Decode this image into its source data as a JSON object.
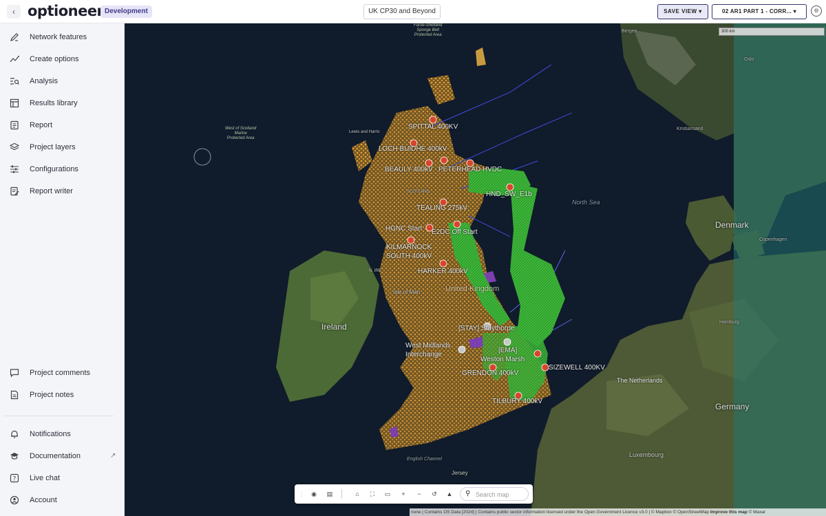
{
  "app": {
    "logo": "optioneer",
    "environment": "Development",
    "project": "UK CP30 and Beyond",
    "save_view": "SAVE VIEW ▾",
    "scenario": "02 AR1 PART 1 - CORR... ▾"
  },
  "sidebar": {
    "items": [
      {
        "label": "Network features",
        "icon": "pen-icon"
      },
      {
        "label": "Create options",
        "icon": "route-icon"
      },
      {
        "label": "Analysis",
        "icon": "analysis-icon"
      },
      {
        "label": "Results library",
        "icon": "table-icon"
      },
      {
        "label": "Report",
        "icon": "report-icon"
      },
      {
        "label": "Project layers",
        "icon": "layers-icon"
      },
      {
        "label": "Configurations",
        "icon": "sliders-icon"
      },
      {
        "label": "Report writer",
        "icon": "report-writer-icon"
      }
    ],
    "bottom_items": [
      {
        "label": "Project comments",
        "icon": "comment-icon"
      },
      {
        "label": "Project notes",
        "icon": "notes-icon"
      },
      {
        "label": "Notifications",
        "icon": "bell-icon"
      },
      {
        "label": "Documentation",
        "icon": "graduation-cap-icon"
      },
      {
        "label": "Live chat",
        "icon": "help-icon"
      },
      {
        "label": "Account",
        "icon": "user-icon"
      }
    ]
  },
  "map": {
    "scale": "300 km",
    "countries": {
      "ireland": "Ireland",
      "denmark": "Denmark",
      "germany": "Germany",
      "netherlands": "The Netherlands",
      "uk": "United Kingdom"
    },
    "places": {
      "bergen": "Bergen",
      "oslo": "Oslo",
      "kristiansand": "Kristiansand",
      "hamburg": "Hamburg",
      "luxembourg": "Luxembourg",
      "jersey": "Jersey",
      "isle_of_man": "Isle of Man",
      "n_ireland": "N. IRE",
      "scotland": "SCOTLAND",
      "english_channel": "English Channel",
      "north_sea": "North Sea",
      "copenhagen": "Copenhagen",
      "lewis": "Lewis and Harris"
    },
    "marine_areas": {
      "west_scotland": "West of Scotland\nMarine\nProtected Area",
      "sponge_belt": "Faroe-Shetland\nSponge Belt\nProtected Area"
    },
    "substations": [
      {
        "label": "SPITTAL 400KV"
      },
      {
        "label": "LOCH BUIDHE 400kV"
      },
      {
        "label": "BEAULY 400kV"
      },
      {
        "label": "PETERHEAD HVDC"
      },
      {
        "label": "HND_SW_E1b"
      },
      {
        "label": "TEALING 275kV"
      },
      {
        "label": "HGNC Start"
      },
      {
        "label": "E2DC Off Start"
      },
      {
        "label": "KILMARNOCK SOUTH 400kV"
      },
      {
        "label": "HARKER 400kV"
      },
      {
        "label": "[STAY] Staythorpe"
      },
      {
        "label": "West Midlands Interchange"
      },
      {
        "label": "[EMA]"
      },
      {
        "label": "Weston Marsh"
      },
      {
        "label": "SIZEWELL 400KV"
      },
      {
        "label": "GRENDON 400kV"
      },
      {
        "label": "TILBURY 400kV"
      }
    ],
    "search_placeholder": "Search map",
    "attribution": "none | Contains OS Data [2024] | Contains public sector information licensed under the Open Government Licence v3.0 | © Mapbox © OpenStreetMap ",
    "attribution_bold": "Improve this map",
    "attribution_end": " © Maxar"
  },
  "colors": {
    "accent": "#32346b",
    "route_green": "#3db83a",
    "constraint_orange": "#e8a23a",
    "substation_red": "#d9452b"
  }
}
